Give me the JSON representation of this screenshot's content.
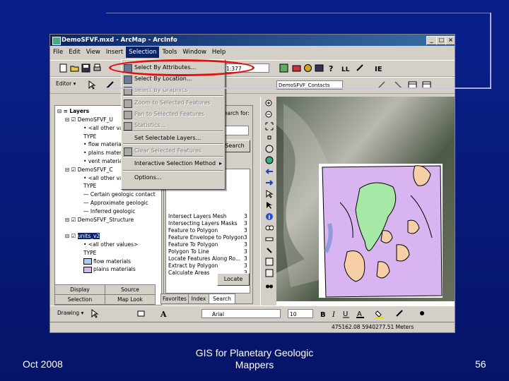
{
  "window": {
    "title": "DemoSFVF.mxd - ArcMap - ArcInfo",
    "controls": {
      "minimize": "_",
      "maximize": "□",
      "close": "×"
    }
  },
  "menubar": {
    "items": [
      "File",
      "Edit",
      "View",
      "Insert",
      "Selection",
      "Tools",
      "Window",
      "Help"
    ],
    "active": "Selection"
  },
  "toolbar": {
    "scale_value": "1:377",
    "layer_combo": "DemoSFVF_Contacts",
    "editor_label": "Editor"
  },
  "selection_menu": {
    "items": [
      {
        "label": "Select By Attributes...",
        "disabled": false,
        "icon": "select-by-attributes-icon"
      },
      {
        "label": "Select By Location...",
        "disabled": false,
        "icon": "select-by-location-icon"
      },
      {
        "label": "Select By Graphics",
        "disabled": true,
        "icon": "select-by-graphics-icon"
      },
      {
        "label": "Zoom to Selected Features",
        "disabled": true,
        "icon": "zoom-selected-icon"
      },
      {
        "label": "Pan to Selected Features",
        "disabled": true,
        "icon": "pan-selected-icon"
      },
      {
        "label": "Statistics...",
        "disabled": true,
        "icon": "statistics-icon"
      },
      {
        "label": "Set Selectable Layers...",
        "disabled": false,
        "icon": ""
      },
      {
        "label": "Clear Selected Features",
        "disabled": true,
        "icon": "clear-selection-icon"
      },
      {
        "label": "Interactive Selection Method",
        "disabled": false,
        "icon": "",
        "submenu": true
      },
      {
        "label": "Options...",
        "disabled": false,
        "icon": ""
      }
    ]
  },
  "toc": {
    "root": "Layers",
    "rows": [
      {
        "text": "DemoSFVF_U",
        "level": 1,
        "type": "layer"
      },
      {
        "text": "<all other values>",
        "level": 2,
        "type": "sym"
      },
      {
        "text": "TYPE",
        "level": 2,
        "type": "plain"
      },
      {
        "text": "flow materials",
        "level": 2,
        "type": "sym"
      },
      {
        "text": "plains materials",
        "level": 2,
        "type": "sym"
      },
      {
        "text": "vent materials",
        "level": 2,
        "type": "sym"
      },
      {
        "text": "DemoSFVF_C",
        "level": 1,
        "type": "layer"
      },
      {
        "text": "<all other values>",
        "level": 2,
        "type": "sym"
      },
      {
        "text": "TYPE",
        "level": 2,
        "type": "plain"
      },
      {
        "text": "Certain geologic contact",
        "level": 2,
        "type": "line"
      },
      {
        "text": "Approximate geologic",
        "level": 2,
        "type": "line"
      },
      {
        "text": "Inferred geologic",
        "level": 2,
        "type": "line"
      },
      {
        "text": "DemoSFVF_Structure",
        "level": 1,
        "type": "layer"
      },
      {
        "text": "",
        "level": 2,
        "type": "blank"
      },
      {
        "text": "units_v2",
        "level": 1,
        "type": "layer-selected"
      },
      {
        "text": "<all other values>",
        "level": 2,
        "type": "sym"
      },
      {
        "text": "TYPE",
        "level": 2,
        "type": "plain"
      },
      {
        "text": "flow materials",
        "level": 2,
        "type": "fill-blue"
      },
      {
        "text": "plains materials",
        "level": 2,
        "type": "fill-purple"
      }
    ],
    "tabs": [
      "Display",
      "Source",
      "Selection",
      "Map Look"
    ]
  },
  "search_panel": {
    "search_for": "Search for:",
    "search_button": "Search",
    "list_items": [
      "Intersect Layers Mesh",
      "Intersecting Layers Masks",
      "Feature to Polygon",
      "Feature Envelope to Polygon",
      "Feature To Polygon",
      "Polygon To Line",
      "Locate Features Along Ro...",
      "Extract by Polygon",
      "Calculate Areas"
    ],
    "list_nums": [
      "3",
      "3",
      "3",
      "3",
      "3",
      "3",
      "3",
      "3",
      "3"
    ],
    "locate_button": "Locate",
    "tabs": [
      "Favorites",
      "Index",
      "Search"
    ]
  },
  "drawing_toolbar": {
    "drawing_label": "Drawing",
    "font": "Arial",
    "size": "10"
  },
  "statusbar": {
    "coords": "475162.08  5940277.51 Meters"
  },
  "map_colors": {
    "plains": "#d8b4f0",
    "flow": "#a6e8a6",
    "vent": "#f6cfa6",
    "outline": "#000000"
  },
  "slide": {
    "date": "Oct 2008",
    "title_line1": "GIS for Planetary Geologic",
    "title_line2": "Mappers",
    "page": "56"
  }
}
